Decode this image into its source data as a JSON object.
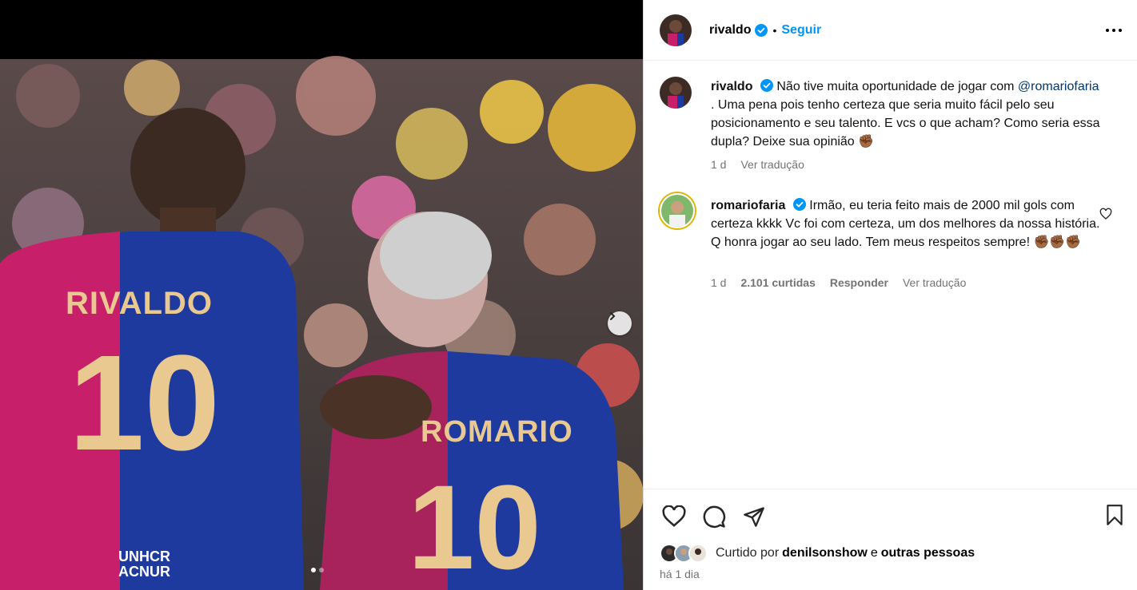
{
  "post": {
    "author": "rivaldo",
    "follow_label": "Seguir",
    "separator": "•",
    "jersey_left_name": "RIVALDO",
    "jersey_left_number": "10",
    "jersey_right_name": "ROMARIO",
    "jersey_right_number": "10",
    "sponsor_line1": "UNHCR",
    "sponsor_line2": "ACNUR",
    "carousel_index": 1,
    "carousel_total": 2
  },
  "caption": {
    "author": "rivaldo",
    "mention": "@romariofaria",
    "text_before": "Não tive muita oportunidade de jogar com",
    "text_after": ". Uma pena pois tenho certeza que seria muito fácil pelo seu posicionamento e seu talento. E vcs o que acham? Como seria essa dupla? Deixe sua opinião ✊🏾",
    "age": "1 d",
    "translate": "Ver tradução"
  },
  "comment": {
    "author": "romariofaria",
    "text": "Irmão, eu teria feito mais de 2000 mil gols com certeza kkkk Vc foi com certeza, um dos melhores da nossa história. Q honra jogar ao seu lado. Tem meus respeitos sempre! ✊🏾✊🏾✊🏾",
    "age": "1 d",
    "likes": "2.101 curtidas",
    "reply": "Responder",
    "translate": "Ver tradução"
  },
  "footer": {
    "liked_by_prefix": "Curtido por",
    "liked_by_user": "denilsonshow",
    "liked_by_and": "e",
    "liked_by_others": "outras pessoas",
    "time": "há 1 dia"
  },
  "colors": {
    "accent": "#0095f6",
    "verified": "#0095f6",
    "muted": "#737373",
    "mention": "#00376b"
  }
}
